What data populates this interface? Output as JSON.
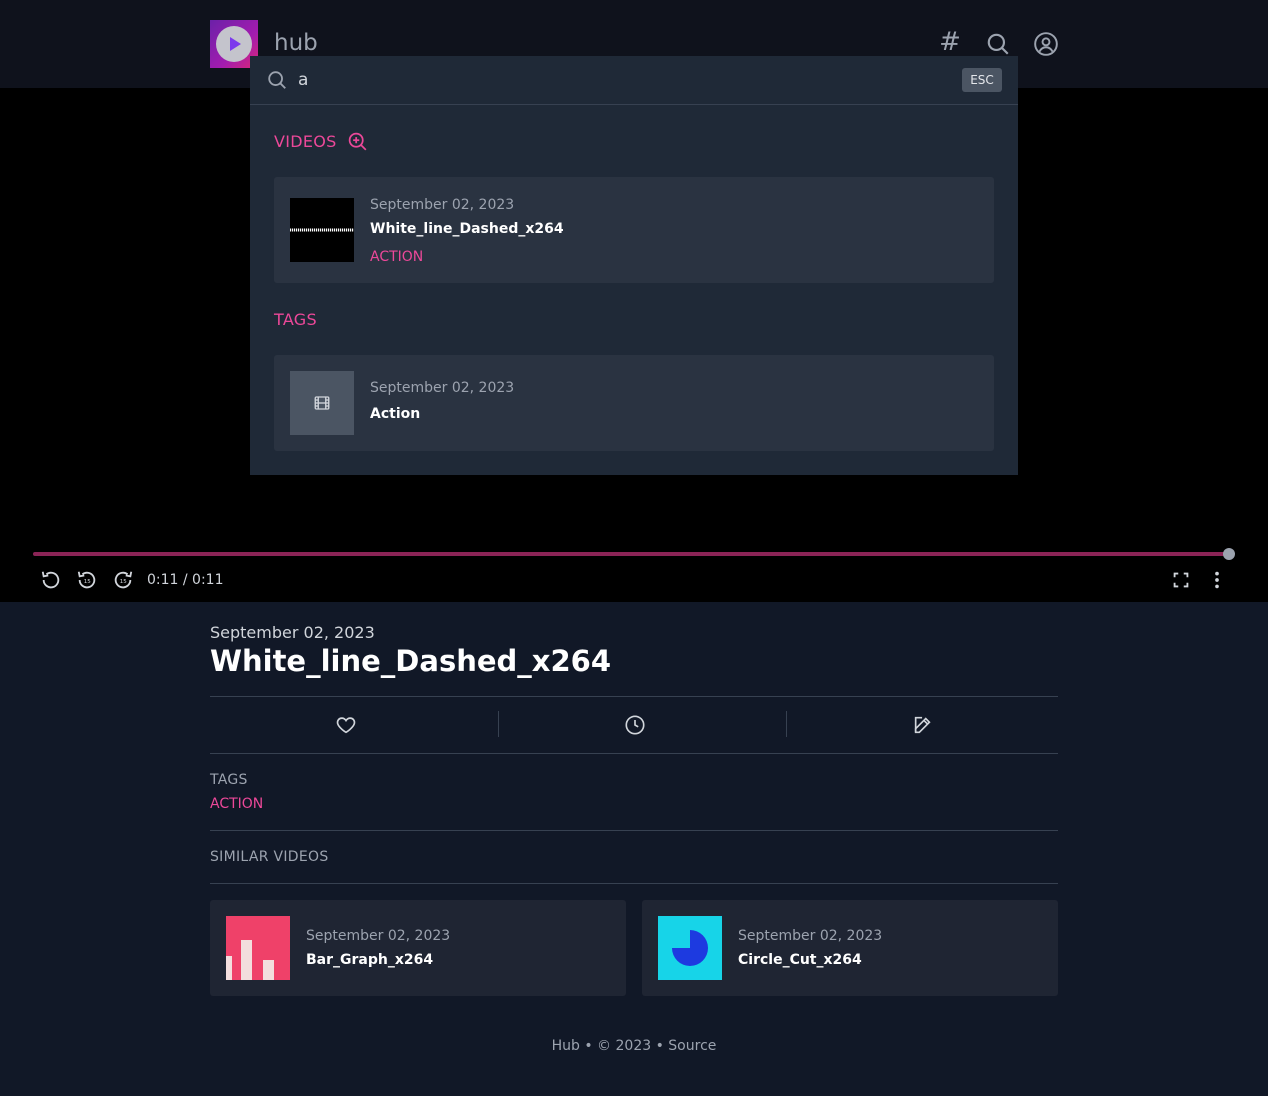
{
  "header": {
    "brand": "hub",
    "tags_glyph": "#"
  },
  "search": {
    "value": "a",
    "esc_label": "ESC",
    "videos_title": "VIDEOS",
    "tags_title": "TAGS",
    "video_results": [
      {
        "date": "September 02, 2023",
        "title": "White_line_Dashed_x264",
        "tag": "ACTION"
      }
    ],
    "tag_results": [
      {
        "date": "September 02, 2023",
        "title": "Action"
      }
    ]
  },
  "player": {
    "time": "0:11 / 0:11",
    "progress": 1.0
  },
  "video": {
    "date": "September 02, 2023",
    "title": "White_line_Dashed_x264",
    "tags_label": "TAGS",
    "tags": [
      "ACTION"
    ]
  },
  "similar": {
    "label": "SIMILAR VIDEOS",
    "items": [
      {
        "date": "September 02, 2023",
        "title": "Bar_Graph_x264"
      },
      {
        "date": "September 02, 2023",
        "title": "Circle_Cut_x264"
      }
    ]
  },
  "footer": {
    "text": "Hub • © 2023 • Source"
  },
  "colors": {
    "accent": "#ec4899",
    "background": "#111827",
    "panel": "#1f2937"
  },
  "icons": [
    "play-logo-icon",
    "hash-icon",
    "search-icon",
    "user-circle-icon",
    "replay-icon",
    "rewind-15-icon",
    "forward-15-icon",
    "fullscreen-icon",
    "more-vertical-icon",
    "zoom-in-icon",
    "film-icon",
    "heart-icon",
    "clock-icon",
    "edit-icon"
  ]
}
